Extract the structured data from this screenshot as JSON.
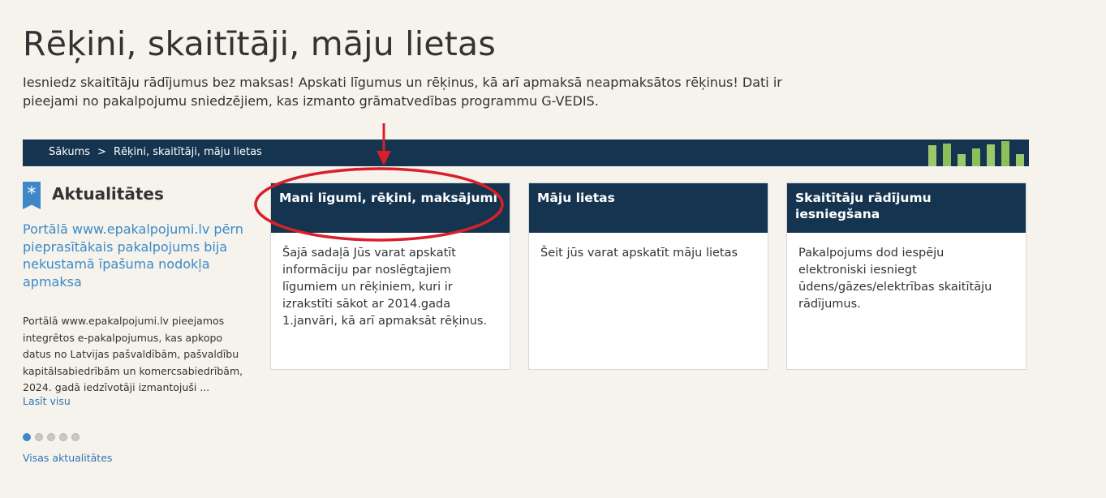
{
  "header": {
    "title": "Rēķini, skaitītāji, māju lietas",
    "lead": "Iesniedz skaitītāju rādījumus bez maksas! Apskati līgumus un rēķinus, kā arī apmaksā neapmaksātos rēķinus! Dati ir pieejami no pakalpojumu sniedzējiem, kas izmanto grāmatvedības programmu G-VEDIS."
  },
  "breadcrumb": {
    "home": "Sākums",
    "separator": ">",
    "current": "Rēķini, skaitītāji, māju lietas"
  },
  "news": {
    "title": "Aktualitātes",
    "headline": "Portālā www.epakalpojumi.lv pērn pieprasītākais pakalpojums bija nekustamā īpašuma nodokļa apmaksa",
    "body": "Portālā www.epakalpojumi.lv pieejamos integrētos e-pakalpojumus, kas apkopo datus no Latvijas pašvaldībām, pašvaldību kapitālsabiedrībām un komercsabiedrībām, 2024. gadā iedzīvotāji izmantojuši ...",
    "read_more": "Lasīt visu",
    "all_news": "Visas aktualitātes",
    "active_slide": 1,
    "slide_count": 5
  },
  "cards": [
    {
      "title": "Mani līgumi, rēķini, maksājumi",
      "text": "Šajā sadaļā Jūs varat apskatīt informāciju par noslēgtajiem līgumiem un rēķiniem, kuri ir izrakstīti sākot ar 2014.gada 1.janvāri, kā arī apmaksāt rēķinus."
    },
    {
      "title": "Māju lietas",
      "text": "Šeit jūs varat apskatīt māju lietas"
    },
    {
      "title": "Skaitītāju rādījumu iesniegšana",
      "text": "Pakalpojums dod iespēju elektroniski iesniegt ūdens/gāzes/elektrības skaitītāju rādījumus."
    }
  ],
  "colors": {
    "navy": "#15344f",
    "link": "#3a89c9",
    "accent_green": "#9bc86c",
    "annotation_red": "#d9202a",
    "background": "#f6f3ec"
  }
}
